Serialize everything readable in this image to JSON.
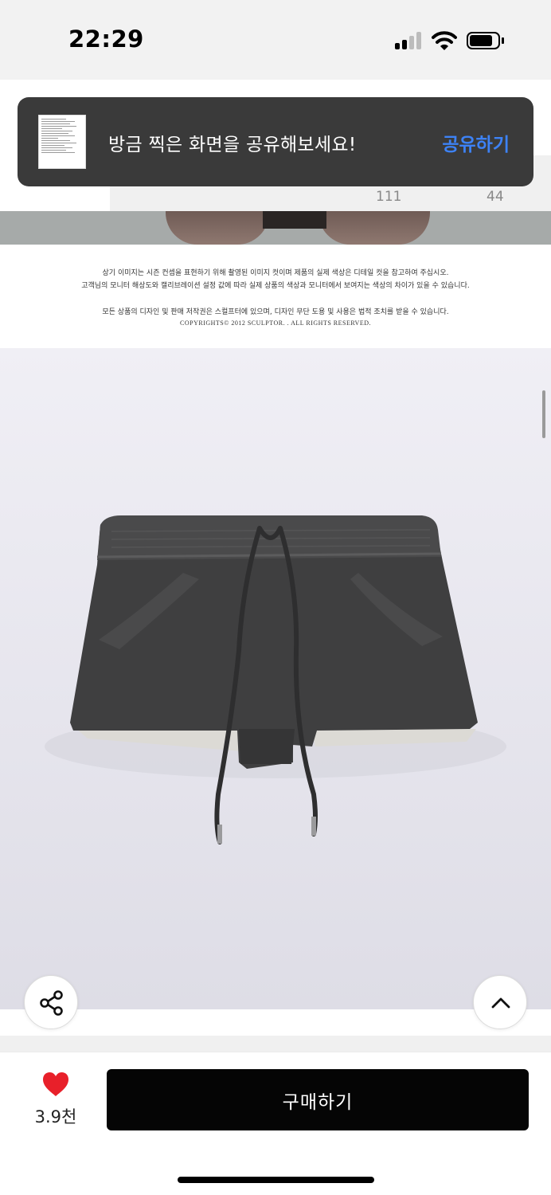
{
  "status_bar": {
    "time": "22:29"
  },
  "toast": {
    "message": "방금 찍은 화면을 공유해보세요!",
    "action": "공유하기"
  },
  "tab_strip": {
    "counts": [
      "111",
      "44"
    ]
  },
  "notice": {
    "lines": [
      "상기 이미지는 시즌 컨셉을 표현하기 위해 촬영된 이미지 컷이며 제품의 실제 색상은 디테일 컷을 참고하여 주십시오.",
      "고객님의 모니터 해상도와 캘리브레이션 설정 값에 따라 실제 상품의 색상과 모니터에서 보여지는 색상의 차이가 있을 수 있습니다.",
      "모든 상품의 디자인 및 판매 저작권은 스컬프터에 있으며, 디자인 무단 도용 및 사용은 법적 조치를 받을 수 있습니다.",
      "COPYRIGHTS© 2012 SCULPTOR. . ALL RIGHTS RESERVED."
    ]
  },
  "bottom_bar": {
    "like_count": "3.9천",
    "buy_label": "구매하기"
  },
  "colors": {
    "accent": "#3d82f6",
    "like": "#e8202a",
    "buy_button": "#050505",
    "toast_bg": "#3a3a3a"
  },
  "icons": [
    "signal-icon",
    "wifi-icon",
    "battery-icon",
    "share-icon",
    "chevron-up-icon",
    "heart-icon"
  ]
}
